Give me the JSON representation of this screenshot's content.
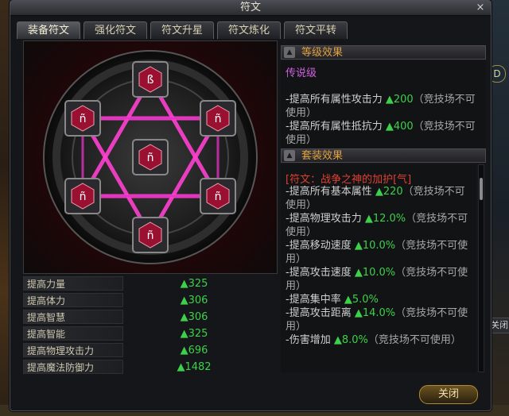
{
  "window": {
    "title": "符文",
    "close_symbol": "×"
  },
  "tabs": [
    {
      "label": "装备符文",
      "active": true
    },
    {
      "label": "强化符文",
      "active": false
    },
    {
      "label": "符文升星",
      "active": false
    },
    {
      "label": "符文炼化",
      "active": false
    },
    {
      "label": "符文平转",
      "active": false
    }
  ],
  "rune_glyphs": [
    "ß",
    "ñ",
    "ñ",
    "ñ",
    "ñ",
    "ñ",
    "ñ"
  ],
  "stats": [
    {
      "label": "提高力量",
      "value": "▲325"
    },
    {
      "label": "提高体力",
      "value": "▲306"
    },
    {
      "label": "提高智慧",
      "value": "▲306"
    },
    {
      "label": "提高智能",
      "value": "▲325"
    },
    {
      "label": "提高物理攻击力",
      "value": "▲696"
    },
    {
      "label": "提高魔法防御力",
      "value": "▲1482"
    }
  ],
  "level_effect": {
    "header": "等级效果",
    "grade": "传说级",
    "lines": [
      {
        "text": "-提高所有属性攻击力 ",
        "value": "▲200",
        "note": "（竞技场不可使用）"
      },
      {
        "text": "-提高所有属性抵抗力 ",
        "value": "▲400",
        "note": "（竞技场不可使用）"
      }
    ]
  },
  "set_effect": {
    "header": "套装效果",
    "title": "[符文：战争之神的加护[气]",
    "lines": [
      {
        "text": " -提高所有基本属性 ",
        "value": "▲220",
        "note": "（竞技场不可使用）"
      },
      {
        "text": " -提高物理攻击力 ",
        "value": "▲12.0%",
        "note": "（竞技场不可使用）"
      },
      {
        "text": " -提高移动速度 ",
        "value": "▲10.0%",
        "note": "（竞技场不可使用）"
      },
      {
        "text": " -提高攻击速度 ",
        "value": "▲10.0%",
        "note": "（竞技场不可使用）"
      },
      {
        "text": " -提高集中率 ",
        "value": "▲5.0%",
        "note": ""
      },
      {
        "text": " -提高攻击距离 ",
        "value": "▲14.0%",
        "note": "（竞技场不可使用）"
      },
      {
        "text": " -伤害增加 ",
        "value": "▲8.0%",
        "note": "（竞技场不可使用）"
      }
    ]
  },
  "buttons": {
    "close": "关闭",
    "side": "关闭",
    "side_d": "D"
  },
  "colors": {
    "accent": "#e0a040",
    "green": "#3ed04a",
    "legend": "#d060e0",
    "set_title": "#e04030",
    "magenta": "#ff40d0"
  }
}
